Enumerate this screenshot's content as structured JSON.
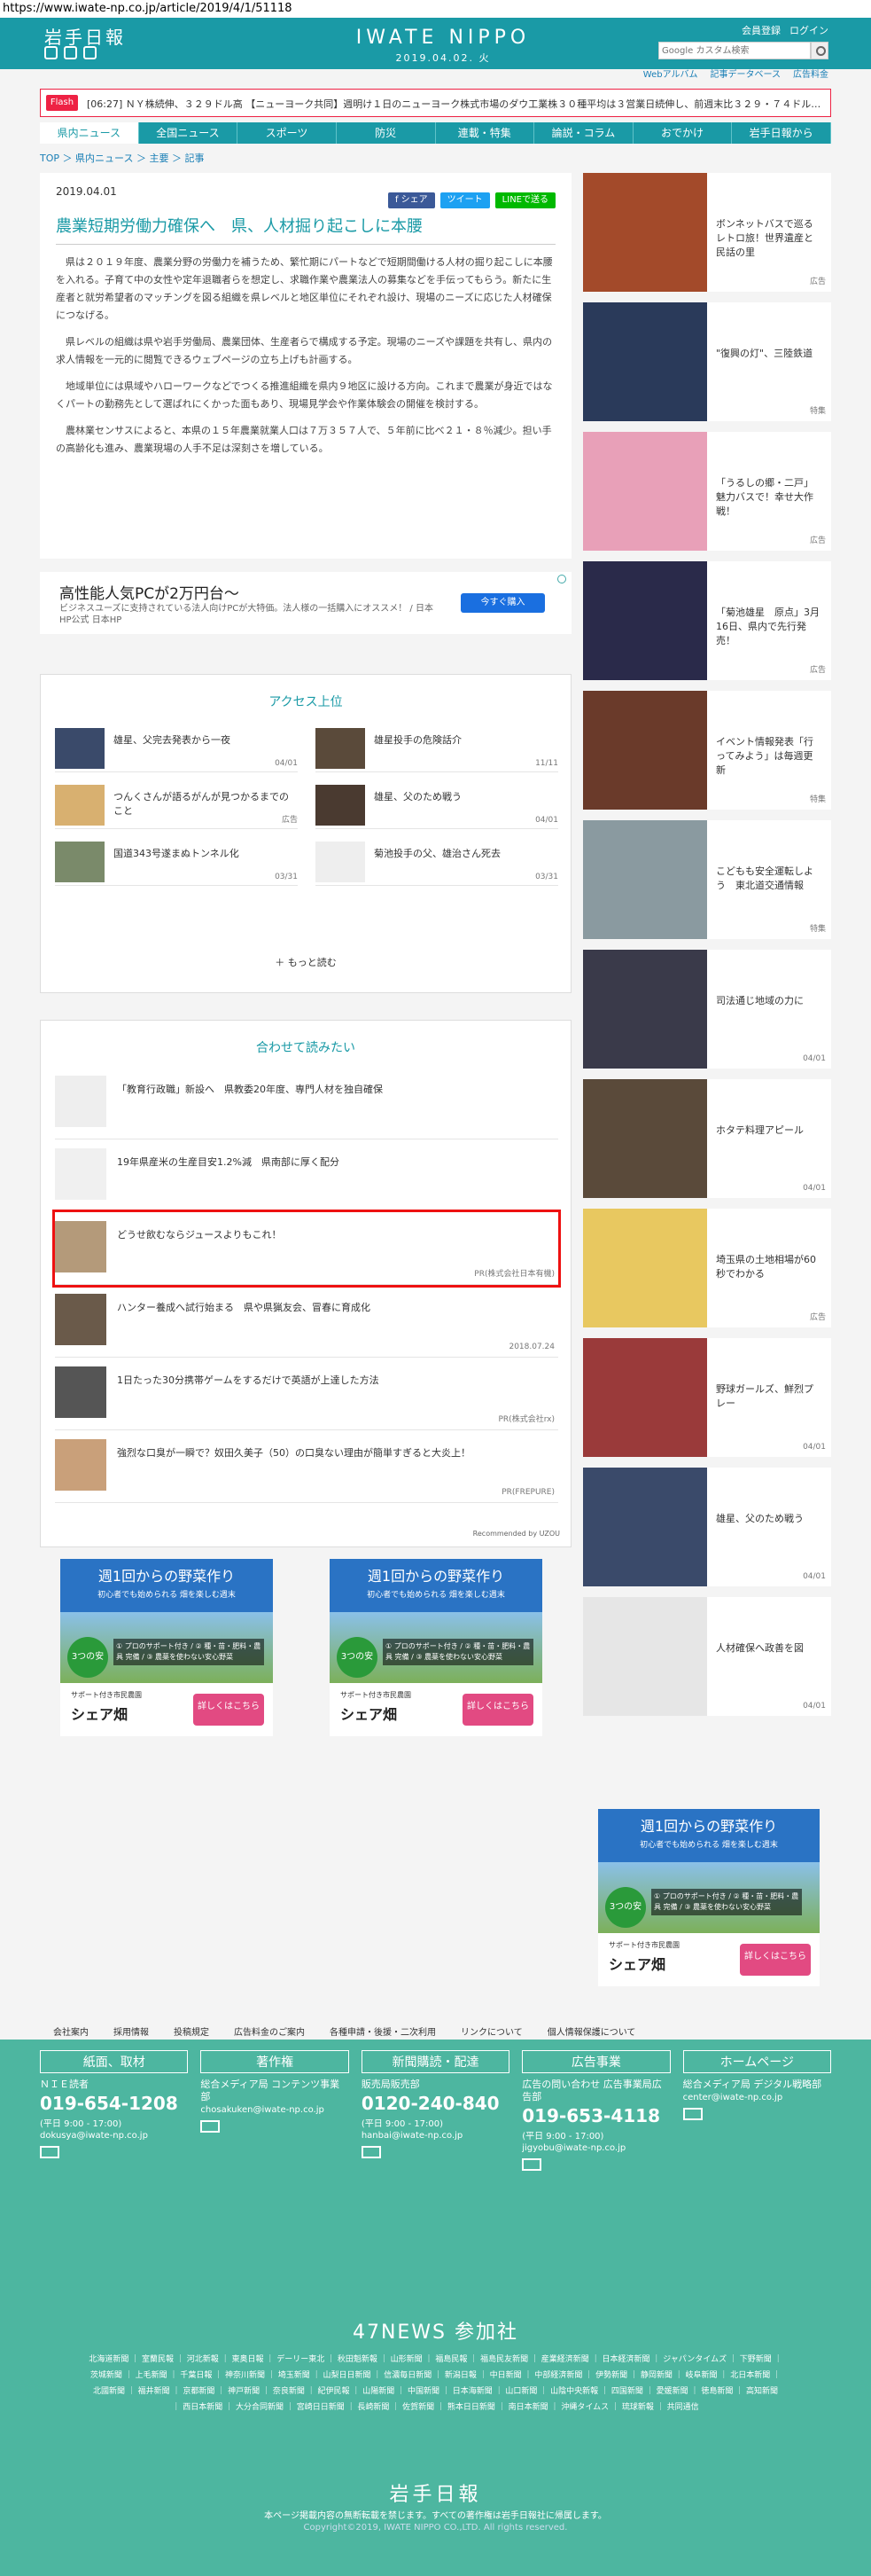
{
  "browser": {
    "url": "https://www.iwate-np.co.jp/article/2019/4/1/51118"
  },
  "header": {
    "logo": "岩手日報",
    "brand": "IWATE NIPPO",
    "date": "2019.04.02. 火",
    "link_register": "会員登録",
    "link_login": "ログイン",
    "search_placeholder": "Google カスタム検索"
  },
  "subnav": [
    "Webアルバム",
    "記事データベース",
    "広告料金"
  ],
  "flash": {
    "tag": "Flash",
    "text": "[06:27] ＮＹ株続伸、３２９ドル高 【ニューヨーク共同】週明け１日のニューヨーク株式市場のダウ工業株３０種平均は３営業日続伸し、前週末比３２９・７４ドル…"
  },
  "mainnav": [
    "県内ニュース",
    "全国ニュース",
    "スポーツ",
    "防災",
    "連載・特集",
    "論説・コラム",
    "おでかけ",
    "岩手日報から"
  ],
  "breadcrumb": "TOP ＞ 県内ニュース ＞ 主要 ＞ 記事",
  "article": {
    "date": "2019.04.01",
    "share": [
      "f シェア",
      "ツイート",
      "LINEで送る"
    ],
    "title": "農業短期労働力確保へ　県、人材掘り起こしに本腰",
    "paragraphs": [
      "県は２０１９年度、農業分野の労働力を補うため、繁忙期にパートなどで短期間働ける人材の掘り起こしに本腰を入れる。子育て中の女性や定年退職者らを想定し、求職作業や農業法人の募集などを手伝ってもらう。新たに生産者と就労希望者のマッチングを図る組織を県レベルと地区単位にそれぞれ設け、現場のニーズに応じた人材確保につなげる。",
      "県レベルの組織は県や岩手労働局、農業団体、生産者らで構成する予定。現場のニーズや課題を共有し、県内の求人情報を一元的に閲覧できるウェブページの立ち上げも計画する。",
      "地域単位には県域やハローワークなどでつくる推進組織を県内９地区に設ける方向。これまで農業が身近ではなくパートの勤務先として選ばれにくかった面もあり、現場見学会や作業体験会の開催を検討する。",
      "農林業センサスによると、本県の１５年農業就業人口は７万３５７人で、５年前に比べ２１・８％減少。担い手の高齢化も進み、農業現場の人手不足は深刻さを増している。"
    ]
  },
  "ad": {
    "title": "高性能人気PCが2万円台〜",
    "desc": "ビジネスユーズに支持されている法人向けPCが大特価。法人様の一括購入にオススメ！ / 日本HP公式 日本HP",
    "button": "今すぐ購入"
  },
  "access": {
    "heading": "アクセス上位",
    "items": [
      {
        "title": "雄星、父完去発表から一夜",
        "date": "04/01"
      },
      {
        "title": "雄星投手の危険話介",
        "date": "11/11"
      },
      {
        "title": "つんくさんが語るがんが見つかるまでのこと",
        "date": "広告"
      },
      {
        "title": "雄星、父のため戦う",
        "date": "04/01"
      },
      {
        "title": "国道343号遂まぬトンネル化",
        "date": "03/31"
      },
      {
        "title": "菊池投手の父、雄治さん死去",
        "date": "03/31"
      }
    ],
    "more": "＋ もっと読む"
  },
  "related": {
    "heading": "合わせて読みたい",
    "items": [
      {
        "title": "「教育行政職」新設へ　県教委20年度、専門人材を独自確保",
        "date": ""
      },
      {
        "title": "19年県産米の生産目安1.2%減　県南部に厚く配分",
        "date": ""
      },
      {
        "title": "どうせ飲むならジュースよりもこれ！",
        "date": "PR(株式会社日本有機)"
      },
      {
        "title": "ハンター養成へ試行始まる　県や県猟友会、冒春に育成化",
        "date": "2018.07.24"
      },
      {
        "title": "1日たった30分携帯ゲームをするだけで英語が上達した方法",
        "date": "PR(株式会社rx)"
      },
      {
        "title": "強烈な口臭が一瞬で？奴田久美子（50）の口臭ない理由が簡単すぎると大炎上！",
        "date": "PR(FREPURE)"
      }
    ],
    "recommended": "Recommended by UZOU"
  },
  "banner": {
    "line1": "週1回からの野菜作り",
    "line2": "初心者でも始められる 畑を楽しむ週末",
    "circle": "3つの安心",
    "points": "① プロのサポート付き / ② 種・苗・肥料・農具 完備 / ③ 農薬を使わない安心野菜",
    "sub": "サポート付き市民農園",
    "name": "シェア畑",
    "cta": "詳しくはこちら"
  },
  "side": [
    {
      "title": "ボンネットバスで巡るレトロ旅！世界遺産と民話の里",
      "date": "広告"
    },
    {
      "title": "\"復興の灯\"、三陸鉄道",
      "date": "特集"
    },
    {
      "title": "「うるしの郷・二戸」魅力バスで！幸せ大作戦！",
      "date": "広告"
    },
    {
      "title": "「菊池雄星　原点」3月16日、県内で先行発売！",
      "date": "広告"
    },
    {
      "title": "イベント情報発表「行ってみよう」は毎週更新",
      "date": "特集"
    },
    {
      "title": "こどもも安全運転しよう　東北道交通情報",
      "date": "特集"
    },
    {
      "title": "司法通じ地域の力に",
      "date": "04/01"
    },
    {
      "title": "ホタテ料理アピール",
      "date": "04/01"
    },
    {
      "title": "埼玉県の土地相場が60秒でわかる",
      "date": "広告"
    },
    {
      "title": "野球ガールズ、鮮烈プレー",
      "date": "04/01"
    },
    {
      "title": "雄星、父のため戦う",
      "date": "04/01"
    },
    {
      "title": "人材確保へ政善を図",
      "date": "04/01"
    }
  ],
  "footlinks": [
    "会社案内",
    "採用情報",
    "投稿規定",
    "広告料金のご案内",
    "各種申請・後援・二次利用",
    "リンクについて",
    "個人情報保護について"
  ],
  "footer": {
    "cols": [
      {
        "head": "紙面、取材",
        "lines": "ＮＩＥ読者",
        "phone": "019-654-1208",
        "hours": "(平日 9:00 - 17:00)",
        "mail": "dokusya@iwate-np.co.jp"
      },
      {
        "head": "著作権",
        "lines": "総合メディア局 コンテンツ事業部",
        "phone": "",
        "hours": "",
        "mail": "chosakuken@iwate-np.co.jp"
      },
      {
        "head": "新聞購読・配達",
        "lines": "販売局販売部",
        "phone": "0120-240-840",
        "hours": "(平日 9:00 - 17:00)",
        "mail": "hanbai@iwate-np.co.jp"
      },
      {
        "head": "広告事業",
        "lines": "広告の問い合わせ 広告事業局広告部",
        "phone": "019-653-4118",
        "hours": "(平日 9:00 - 17:00)",
        "mail": "jigyobu@iwate-np.co.jp"
      },
      {
        "head": "ホームページ",
        "lines": "総合メディア局 デジタル戦略部",
        "phone": "",
        "hours": "",
        "mail": "center@iwate-np.co.jp"
      }
    ],
    "n47": "47NEWS 参加社",
    "papers": "北海道新聞 ｜ 室蘭民報 ｜ 河北新報 ｜ 東奥日報 ｜ デーリー東北 ｜ 秋田魁新報 ｜ 山形新聞 ｜ 福島民報 ｜ 福島民友新聞 ｜ 産業経済新聞 ｜ 日本経済新聞 ｜ ジャパンタイムズ ｜ 下野新聞 ｜ 茨城新聞 ｜ 上毛新聞 ｜ 千葉日報 ｜ 神奈川新聞 ｜ 埼玉新聞 ｜ 山梨日日新聞 ｜ 信濃毎日新聞 ｜ 新潟日報 ｜ 中日新聞 ｜ 中部経済新聞 ｜ 伊勢新聞 ｜ 静岡新聞 ｜ 岐阜新聞 ｜ 北日本新聞 ｜ 北國新聞 ｜ 福井新聞 ｜ 京都新聞 ｜ 神戸新聞 ｜ 奈良新聞 ｜ 紀伊民報 ｜ 山陽新聞 ｜ 中国新聞 ｜ 日本海新聞 ｜ 山口新聞 ｜ 山陰中央新報 ｜ 四国新聞 ｜ 愛媛新聞 ｜ 徳島新聞 ｜ 高知新聞 ｜ 西日本新聞 ｜ 大分合同新聞 ｜ 宮崎日日新聞 ｜ 長崎新聞 ｜ 佐賀新聞 ｜ 熊本日日新聞 ｜ 南日本新聞 ｜ 沖縄タイムス ｜ 琉球新報 ｜ 共同通信",
    "logo": "岩手日報",
    "note": "本ページ掲載内容の無断転載を禁じます。すべての著作権は岩手日報社に帰属します。",
    "copy": "Copyright©2019, IWATE NIPPO CO.,LTD. All rights reserved."
  }
}
